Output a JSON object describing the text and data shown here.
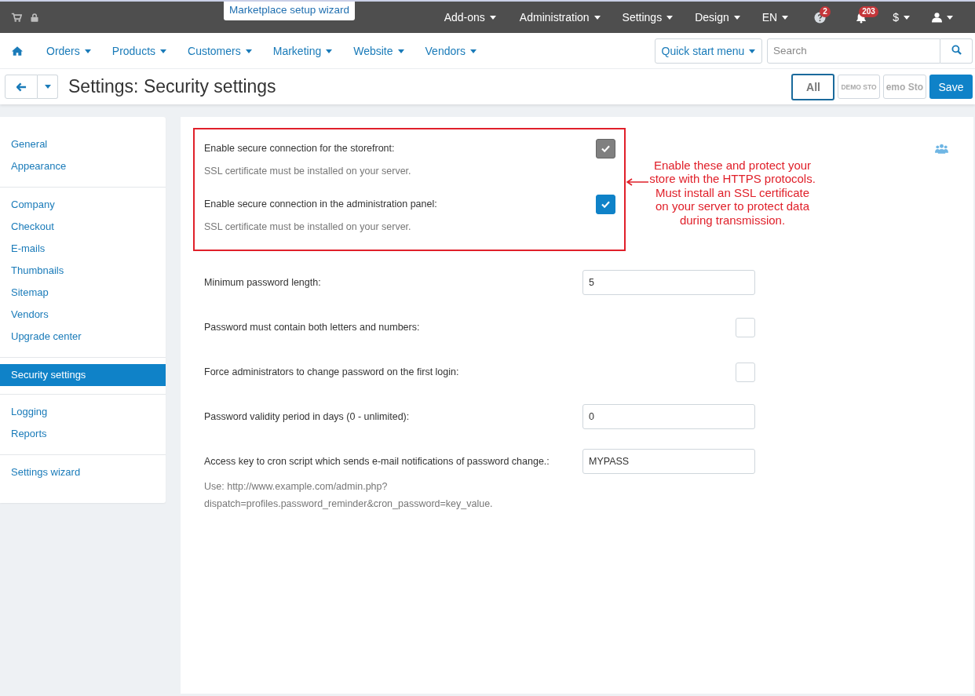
{
  "top_bar": {
    "wizard_tab": "Marketplace setup wizard",
    "menus": [
      {
        "kind": "text",
        "label": "Add-ons"
      },
      {
        "kind": "text",
        "label": "Administration"
      },
      {
        "kind": "text",
        "label": "Settings"
      },
      {
        "kind": "text",
        "label": "Design"
      },
      {
        "kind": "text",
        "label": "EN"
      },
      {
        "kind": "help",
        "badge": "2"
      },
      {
        "kind": "bell",
        "badge": "203"
      },
      {
        "kind": "text",
        "label": "$"
      },
      {
        "kind": "user"
      }
    ]
  },
  "nav": {
    "items": [
      "Orders",
      "Products",
      "Customers",
      "Marketing",
      "Website",
      "Vendors"
    ],
    "quick_start": "Quick start menu",
    "search": {
      "placeholder": "Search"
    }
  },
  "header": {
    "title": "Settings: Security settings",
    "storefronts": [
      {
        "label": "All",
        "selected": true
      },
      {
        "label": "DEMO STO",
        "selected": false
      },
      {
        "label": "emo Sto",
        "selected": false
      }
    ],
    "save": "Save"
  },
  "sidebar": {
    "groups": [
      [
        {
          "label": "General",
          "selected": false
        },
        {
          "label": "Appearance",
          "selected": false
        }
      ],
      [
        {
          "label": "Company",
          "selected": false
        },
        {
          "label": "Checkout",
          "selected": false
        },
        {
          "label": "E-mails",
          "selected": false
        },
        {
          "label": "Thumbnails",
          "selected": false
        },
        {
          "label": "Sitemap",
          "selected": false
        },
        {
          "label": "Vendors",
          "selected": false
        },
        {
          "label": "Upgrade center",
          "selected": false
        }
      ],
      [
        {
          "label": "Security settings",
          "selected": true
        }
      ],
      [
        {
          "label": "Logging",
          "selected": false
        },
        {
          "label": "Reports",
          "selected": false
        }
      ],
      [
        {
          "label": "Settings wizard",
          "selected": false
        }
      ]
    ]
  },
  "highlighted_settings": [
    {
      "kind": "checkbox",
      "label": "Enable secure connection for the storefront:",
      "checked": true,
      "disabled": true,
      "hint": [
        "SSL certificate must be installed on your server."
      ]
    },
    {
      "kind": "checkbox",
      "label": "Enable secure connection in the administration panel:",
      "checked": true,
      "disabled": false,
      "hint": [
        "SSL certificate must be installed on your server."
      ]
    }
  ],
  "annotation": "Enable these and protect your store with the HTTPS protocols. Must install an SSL certificate on your server to protect data during transmission.",
  "settings": [
    {
      "kind": "input",
      "label": "Minimum password length:",
      "value": "5"
    },
    {
      "kind": "checkbox",
      "label": "Password must contain both letters and numbers:",
      "checked": false,
      "disabled": false
    },
    {
      "kind": "checkbox",
      "label": "Force administrators to change password on the first login:",
      "checked": false,
      "disabled": false
    },
    {
      "kind": "input",
      "label": "Password validity period in days (0 - unlimited):",
      "value": "0"
    },
    {
      "kind": "input",
      "label": "Access key to cron script which sends e-mail notifications of password change.:",
      "value": "MYPASS",
      "hint": [
        "Use: http://www.example.com/admin.php?",
        "dispatch=profiles.password_reminder&cron_password=key_value."
      ]
    }
  ]
}
